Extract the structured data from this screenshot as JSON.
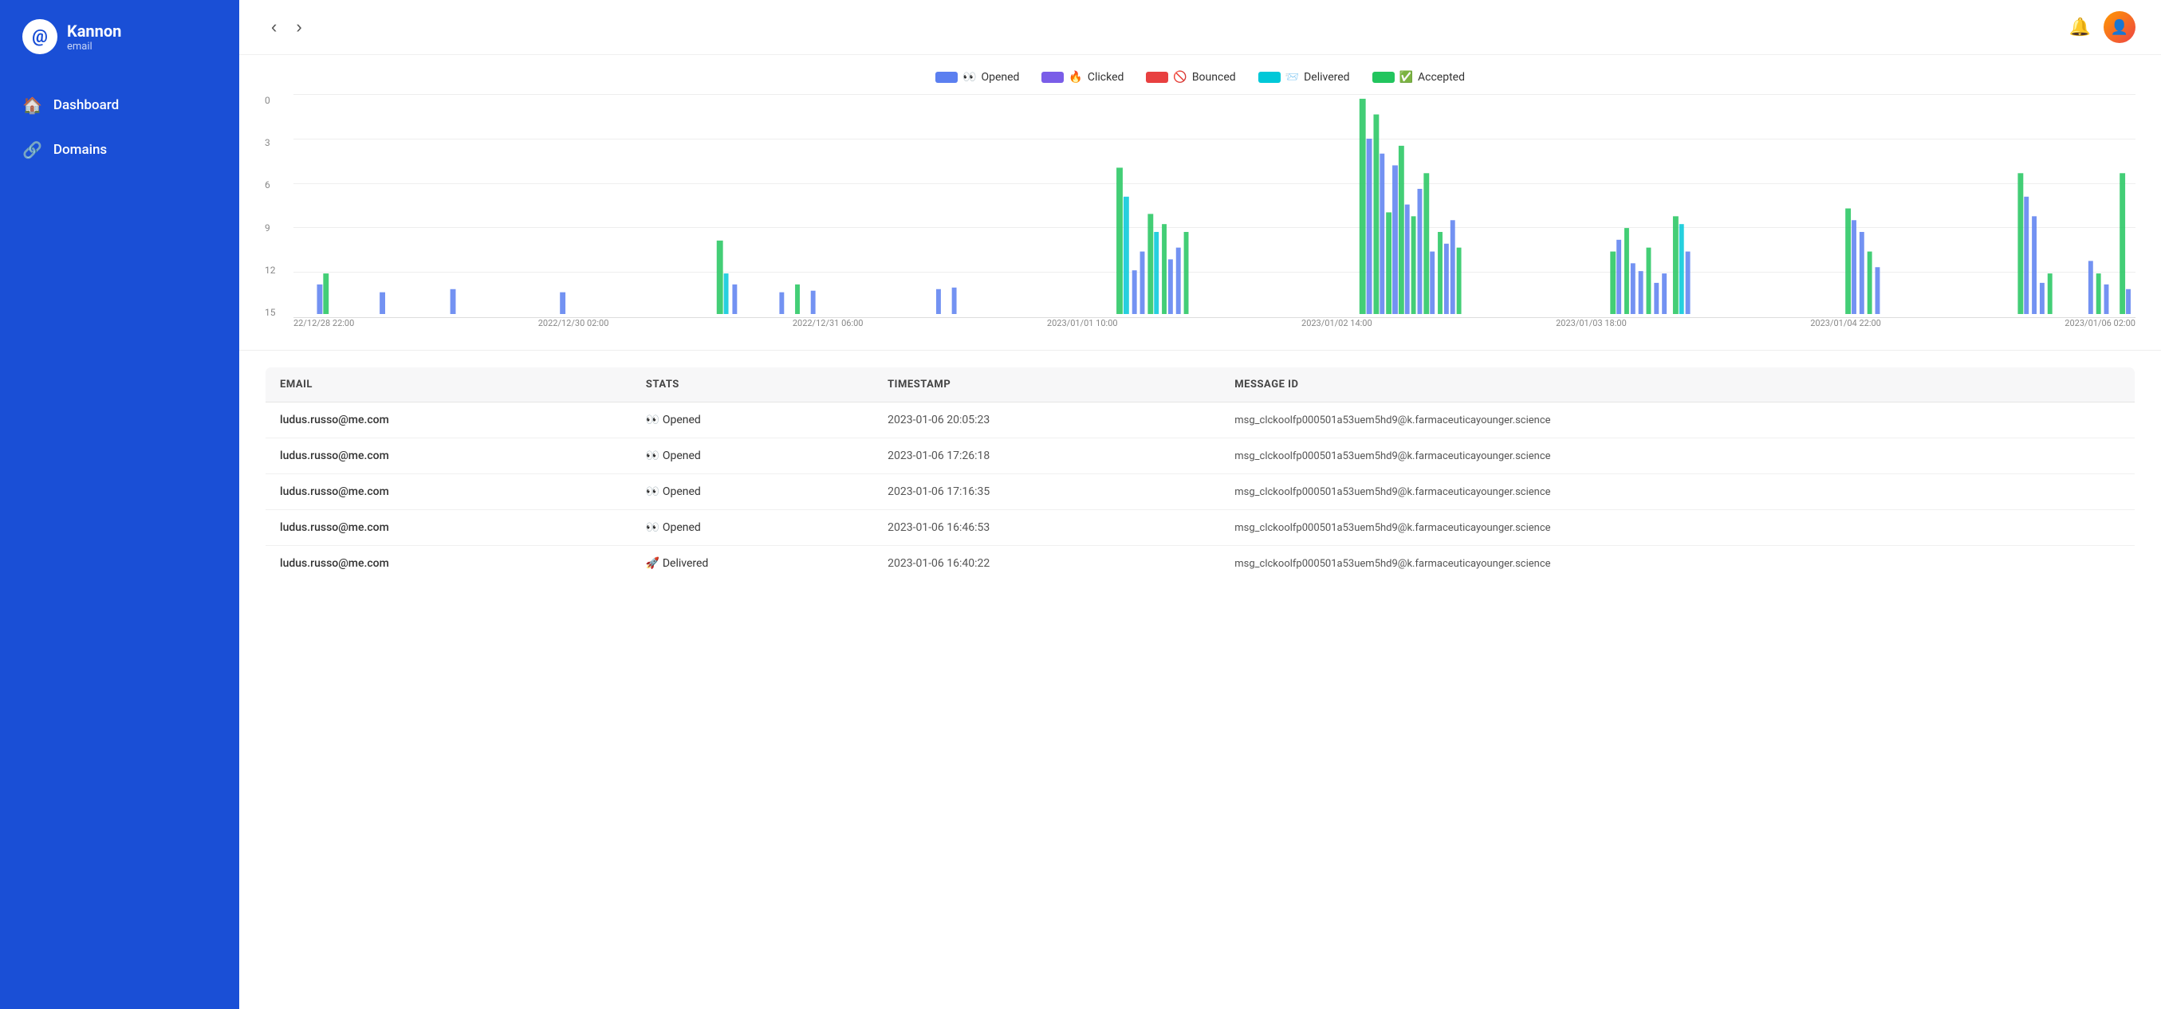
{
  "brand": {
    "icon": "@",
    "name": "Kannon",
    "sub": "email"
  },
  "sidebar": {
    "items": [
      {
        "id": "dashboard",
        "label": "Dashboard",
        "icon": "🏠"
      },
      {
        "id": "domains",
        "label": "Domains",
        "icon": "🔗"
      }
    ]
  },
  "topbar": {
    "back_label": "‹",
    "forward_label": "›"
  },
  "chart": {
    "legend": [
      {
        "id": "opened",
        "label": "Opened",
        "emoji": "👀",
        "color": "#5b7ff0"
      },
      {
        "id": "clicked",
        "label": "Clicked",
        "emoji": "🔥",
        "color": "#7a5de8"
      },
      {
        "id": "bounced",
        "label": "Bounced",
        "emoji": "🚫",
        "color": "#e84040"
      },
      {
        "id": "delivered",
        "label": "Delivered",
        "emoji": "📨",
        "color": "#00c8d8"
      },
      {
        "id": "accepted",
        "label": "Accepted",
        "emoji": "✅",
        "color": "#22c55e"
      }
    ],
    "y_labels": [
      "0",
      "3",
      "6",
      "9",
      "12",
      "15"
    ],
    "x_labels": [
      "22/12/28 22:00",
      "2022/12/30 02:00",
      "2022/12/31 06:00",
      "2023/01/01 10:00",
      "2023/01/02 14:00",
      "2023/01/03 18:00",
      "2023/01/04 22:00",
      "2023/01/06 02:00"
    ]
  },
  "table": {
    "columns": [
      "EMAIL",
      "STATS",
      "TIMESTAMP",
      "MESSAGE ID"
    ],
    "rows": [
      {
        "email": "ludus.russo@me.com",
        "stats": "👀 Opened",
        "timestamp": "2023-01-06 20:05:23",
        "message_id": "msg_clckoolfp000501a53uem5hd9@k.farmaceuticayounger.science"
      },
      {
        "email": "ludus.russo@me.com",
        "stats": "👀 Opened",
        "timestamp": "2023-01-06 17:26:18",
        "message_id": "msg_clckoolfp000501a53uem5hd9@k.farmaceuticayounger.science"
      },
      {
        "email": "ludus.russo@me.com",
        "stats": "👀 Opened",
        "timestamp": "2023-01-06 17:16:35",
        "message_id": "msg_clckoolfp000501a53uem5hd9@k.farmaceuticayounger.science"
      },
      {
        "email": "ludus.russo@me.com",
        "stats": "👀 Opened",
        "timestamp": "2023-01-06 16:46:53",
        "message_id": "msg_clckoolfp000501a53uem5hd9@k.farmaceuticayounger.science"
      },
      {
        "email": "ludus.russo@me.com",
        "stats": "🚀 Delivered",
        "timestamp": "2023-01-06 16:40:22",
        "message_id": "msg_clckoolfp000501a53uem5hd9@k.farmaceuticayounger.science"
      }
    ]
  }
}
